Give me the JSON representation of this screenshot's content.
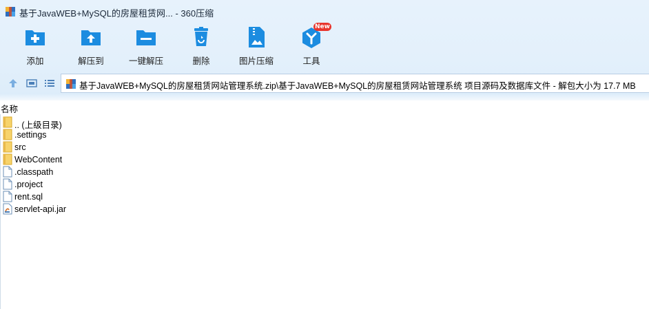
{
  "window": {
    "title": "基于JavaWEB+MySQL的房屋租赁网... - 360压缩"
  },
  "toolbar": {
    "items": [
      {
        "label": "添加",
        "icon": "add-icon"
      },
      {
        "label": "解压到",
        "icon": "extract-to-icon"
      },
      {
        "label": "一键解压",
        "icon": "one-click-extract-icon"
      },
      {
        "label": "删除",
        "icon": "delete-icon"
      },
      {
        "label": "图片压缩",
        "icon": "image-compress-icon"
      },
      {
        "label": "工具",
        "icon": "tools-icon"
      }
    ],
    "badge": "New"
  },
  "navbar": {
    "address": "基于JavaWEB+MySQL的房屋租赁网站管理系统.zip\\基于JavaWEB+MySQL的房屋租赁网站管理系统 项目源码及数据库文件 - 解包大小为 17.7 MB"
  },
  "list": {
    "column_name": "名称",
    "files": [
      {
        "name": ".. (上级目录)",
        "type": "folder"
      },
      {
        "name": ".settings",
        "type": "folder"
      },
      {
        "name": "src",
        "type": "folder"
      },
      {
        "name": "WebContent",
        "type": "folder"
      },
      {
        "name": ".classpath",
        "type": "file"
      },
      {
        "name": ".project",
        "type": "file"
      },
      {
        "name": "rent.sql",
        "type": "file"
      },
      {
        "name": "servlet-api.jar",
        "type": "jar"
      }
    ]
  },
  "colors": {
    "accent": "#1c8ce0",
    "badge": "#e8352d",
    "folder": "#f7d36b"
  }
}
